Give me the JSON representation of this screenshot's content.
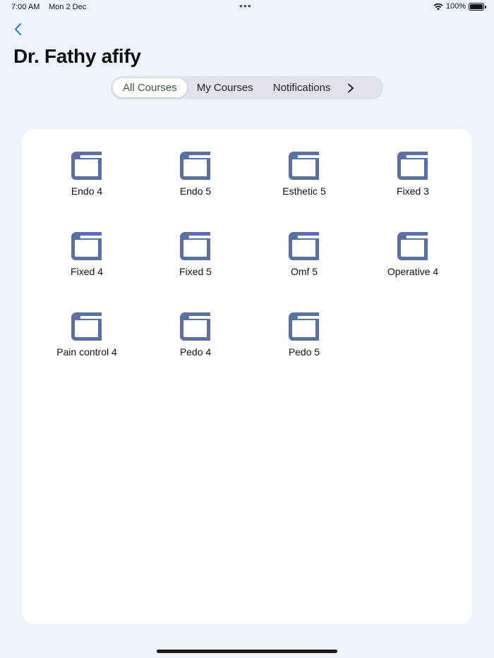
{
  "status": {
    "time": "7:00 AM",
    "date": "Mon 2 Dec",
    "dots": "•••",
    "battery": "100%"
  },
  "page": {
    "title": "Dr. Fathy afify"
  },
  "tabs": [
    {
      "label": "All Courses",
      "active": true
    },
    {
      "label": "My Courses",
      "active": false
    },
    {
      "label": "Notifications",
      "active": false
    }
  ],
  "icons": {
    "back": "chevron-left-icon",
    "more": "chevron-right-icon",
    "course": "book-icon"
  },
  "colors": {
    "accent": "#1f7ae0",
    "active_tab_text": "#3b5e32",
    "book_icon": "#5a6fa3",
    "background": "#eff3fb"
  },
  "courses": [
    {
      "label": "Endo 4"
    },
    {
      "label": "Endo 5"
    },
    {
      "label": "Esthetic 5"
    },
    {
      "label": "Fixed 3"
    },
    {
      "label": "Fixed 4"
    },
    {
      "label": "Fixed 5"
    },
    {
      "label": "Omf 5"
    },
    {
      "label": "Operative 4"
    },
    {
      "label": "Pain control 4"
    },
    {
      "label": "Pedo 4"
    },
    {
      "label": "Pedo 5"
    }
  ]
}
